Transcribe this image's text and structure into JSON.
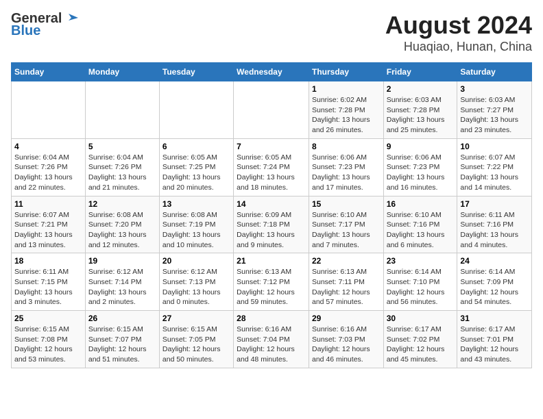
{
  "logo": {
    "line1": "General",
    "line2": "Blue"
  },
  "title": "August 2024",
  "subtitle": "Huaqiao, Hunan, China",
  "days_of_week": [
    "Sunday",
    "Monday",
    "Tuesday",
    "Wednesday",
    "Thursday",
    "Friday",
    "Saturday"
  ],
  "weeks": [
    [
      {
        "day": "",
        "info": ""
      },
      {
        "day": "",
        "info": ""
      },
      {
        "day": "",
        "info": ""
      },
      {
        "day": "",
        "info": ""
      },
      {
        "day": "1",
        "info": "Sunrise: 6:02 AM\nSunset: 7:28 PM\nDaylight: 13 hours and 26 minutes."
      },
      {
        "day": "2",
        "info": "Sunrise: 6:03 AM\nSunset: 7:28 PM\nDaylight: 13 hours and 25 minutes."
      },
      {
        "day": "3",
        "info": "Sunrise: 6:03 AM\nSunset: 7:27 PM\nDaylight: 13 hours and 23 minutes."
      }
    ],
    [
      {
        "day": "4",
        "info": "Sunrise: 6:04 AM\nSunset: 7:26 PM\nDaylight: 13 hours and 22 minutes."
      },
      {
        "day": "5",
        "info": "Sunrise: 6:04 AM\nSunset: 7:26 PM\nDaylight: 13 hours and 21 minutes."
      },
      {
        "day": "6",
        "info": "Sunrise: 6:05 AM\nSunset: 7:25 PM\nDaylight: 13 hours and 20 minutes."
      },
      {
        "day": "7",
        "info": "Sunrise: 6:05 AM\nSunset: 7:24 PM\nDaylight: 13 hours and 18 minutes."
      },
      {
        "day": "8",
        "info": "Sunrise: 6:06 AM\nSunset: 7:23 PM\nDaylight: 13 hours and 17 minutes."
      },
      {
        "day": "9",
        "info": "Sunrise: 6:06 AM\nSunset: 7:23 PM\nDaylight: 13 hours and 16 minutes."
      },
      {
        "day": "10",
        "info": "Sunrise: 6:07 AM\nSunset: 7:22 PM\nDaylight: 13 hours and 14 minutes."
      }
    ],
    [
      {
        "day": "11",
        "info": "Sunrise: 6:07 AM\nSunset: 7:21 PM\nDaylight: 13 hours and 13 minutes."
      },
      {
        "day": "12",
        "info": "Sunrise: 6:08 AM\nSunset: 7:20 PM\nDaylight: 13 hours and 12 minutes."
      },
      {
        "day": "13",
        "info": "Sunrise: 6:08 AM\nSunset: 7:19 PM\nDaylight: 13 hours and 10 minutes."
      },
      {
        "day": "14",
        "info": "Sunrise: 6:09 AM\nSunset: 7:18 PM\nDaylight: 13 hours and 9 minutes."
      },
      {
        "day": "15",
        "info": "Sunrise: 6:10 AM\nSunset: 7:17 PM\nDaylight: 13 hours and 7 minutes."
      },
      {
        "day": "16",
        "info": "Sunrise: 6:10 AM\nSunset: 7:16 PM\nDaylight: 13 hours and 6 minutes."
      },
      {
        "day": "17",
        "info": "Sunrise: 6:11 AM\nSunset: 7:16 PM\nDaylight: 13 hours and 4 minutes."
      }
    ],
    [
      {
        "day": "18",
        "info": "Sunrise: 6:11 AM\nSunset: 7:15 PM\nDaylight: 13 hours and 3 minutes."
      },
      {
        "day": "19",
        "info": "Sunrise: 6:12 AM\nSunset: 7:14 PM\nDaylight: 13 hours and 2 minutes."
      },
      {
        "day": "20",
        "info": "Sunrise: 6:12 AM\nSunset: 7:13 PM\nDaylight: 13 hours and 0 minutes."
      },
      {
        "day": "21",
        "info": "Sunrise: 6:13 AM\nSunset: 7:12 PM\nDaylight: 12 hours and 59 minutes."
      },
      {
        "day": "22",
        "info": "Sunrise: 6:13 AM\nSunset: 7:11 PM\nDaylight: 12 hours and 57 minutes."
      },
      {
        "day": "23",
        "info": "Sunrise: 6:14 AM\nSunset: 7:10 PM\nDaylight: 12 hours and 56 minutes."
      },
      {
        "day": "24",
        "info": "Sunrise: 6:14 AM\nSunset: 7:09 PM\nDaylight: 12 hours and 54 minutes."
      }
    ],
    [
      {
        "day": "25",
        "info": "Sunrise: 6:15 AM\nSunset: 7:08 PM\nDaylight: 12 hours and 53 minutes."
      },
      {
        "day": "26",
        "info": "Sunrise: 6:15 AM\nSunset: 7:07 PM\nDaylight: 12 hours and 51 minutes."
      },
      {
        "day": "27",
        "info": "Sunrise: 6:15 AM\nSunset: 7:05 PM\nDaylight: 12 hours and 50 minutes."
      },
      {
        "day": "28",
        "info": "Sunrise: 6:16 AM\nSunset: 7:04 PM\nDaylight: 12 hours and 48 minutes."
      },
      {
        "day": "29",
        "info": "Sunrise: 6:16 AM\nSunset: 7:03 PM\nDaylight: 12 hours and 46 minutes."
      },
      {
        "day": "30",
        "info": "Sunrise: 6:17 AM\nSunset: 7:02 PM\nDaylight: 12 hours and 45 minutes."
      },
      {
        "day": "31",
        "info": "Sunrise: 6:17 AM\nSunset: 7:01 PM\nDaylight: 12 hours and 43 minutes."
      }
    ]
  ]
}
